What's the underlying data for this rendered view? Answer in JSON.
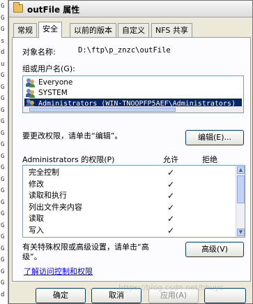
{
  "bg_strip_letters": [
    "G",
    "G",
    "G",
    "s",
    "d",
    "u",
    "G",
    "G",
    "G",
    "G",
    "G",
    "G",
    "G",
    "G",
    "G",
    "G",
    "G",
    "G",
    "G",
    "G",
    "G",
    "G",
    "G",
    "G",
    "G",
    "d"
  ],
  "window": {
    "title": "outFile 属性"
  },
  "tabs": [
    {
      "label": "常规"
    },
    {
      "label": "安全"
    },
    {
      "label": "以前的版本"
    },
    {
      "label": "自定义"
    },
    {
      "label": "NFS 共享"
    }
  ],
  "security": {
    "object_name_label": "对象名称:",
    "object_name_value": "D:\\ftp\\p_znzc\\outFile",
    "group_label": "组或用户名(G):",
    "users": [
      {
        "name": "Everyone",
        "selected": false
      },
      {
        "name": "SYSTEM",
        "selected": false
      },
      {
        "name": "Administrators (WIN-TNOOPFP5AEF\\Administrators)",
        "selected": true
      }
    ],
    "change_perm_text": "要更改权限，请单击“编辑”。",
    "edit_button": "编辑(E)...",
    "perm_title": "Administrators 的权限(P)",
    "allow_header": "允许",
    "deny_header": "拒绝",
    "permissions": [
      {
        "name": "完全控制",
        "allow": "✓",
        "deny": ""
      },
      {
        "name": "修改",
        "allow": "✓",
        "deny": ""
      },
      {
        "name": "读取和执行",
        "allow": "✓",
        "deny": ""
      },
      {
        "name": "列出文件夹内容",
        "allow": "✓",
        "deny": ""
      },
      {
        "name": "读取",
        "allow": "✓",
        "deny": ""
      },
      {
        "name": "写入",
        "allow": "✓",
        "deny": ""
      }
    ],
    "special_text_line1": "有关特殊权限或高级设置，请单击“高",
    "special_text_line2": "级”。",
    "advanced_button": "高级(V)",
    "learn_link": "了解访问控制和权限"
  },
  "footer": {
    "ok": "确定",
    "cancel": "取消",
    "apply": "应用(A)"
  },
  "watermark": "https://blog.csdn.net/hhvyc"
}
